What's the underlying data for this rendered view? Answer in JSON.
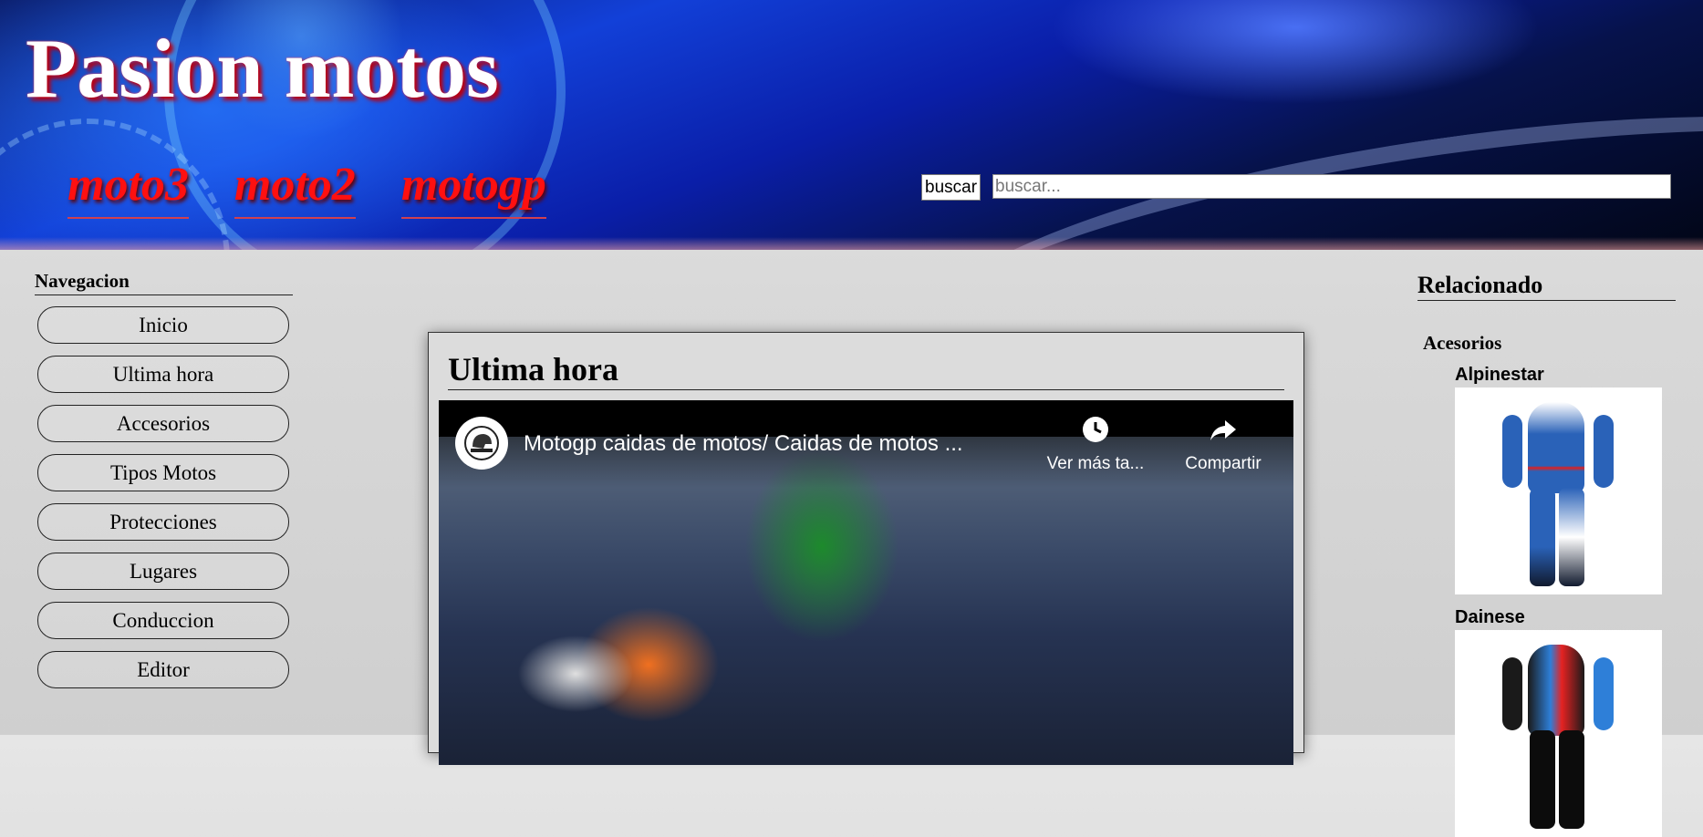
{
  "header": {
    "site_title": "Pasion motos",
    "nav": [
      {
        "label": "moto3"
      },
      {
        "label": "moto2"
      },
      {
        "label": "motogp"
      }
    ],
    "search": {
      "button_label": "buscar",
      "placeholder": "buscar..."
    }
  },
  "sidebar": {
    "heading": "Navegacion",
    "items": [
      {
        "label": "Inicio"
      },
      {
        "label": "Ultima hora"
      },
      {
        "label": "Accesorios"
      },
      {
        "label": "Tipos Motos"
      },
      {
        "label": "Protecciones"
      },
      {
        "label": "Lugares"
      },
      {
        "label": "Conduccion"
      },
      {
        "label": "Editor"
      }
    ]
  },
  "main": {
    "title": "Ultima hora",
    "video": {
      "title": "Motogp caidas de motos/ Caidas de motos ...",
      "watch_later_label": "Ver más ta...",
      "share_label": "Compartir",
      "watch_later_icon": "clock-icon",
      "share_icon": "share-arrow-icon",
      "channel_icon": "helmet-icon"
    }
  },
  "related": {
    "heading": "Relacionado",
    "category": "Acesorios",
    "products": [
      {
        "name": "Alpinestar",
        "colors": {
          "primary": "#2a62b8",
          "secondary": "#ffffff",
          "accent": "#e02020",
          "dark": "#111a2e"
        }
      },
      {
        "name": "Dainese",
        "colors": {
          "primary": "#1a1a1a",
          "secondary": "#2e7fd8",
          "accent": "#e52222",
          "dark": "#0c0c0c"
        }
      }
    ]
  },
  "colors": {
    "title_text": "#ffffff",
    "title_shadow": "#b80012",
    "nav_link": "#ff1010"
  }
}
